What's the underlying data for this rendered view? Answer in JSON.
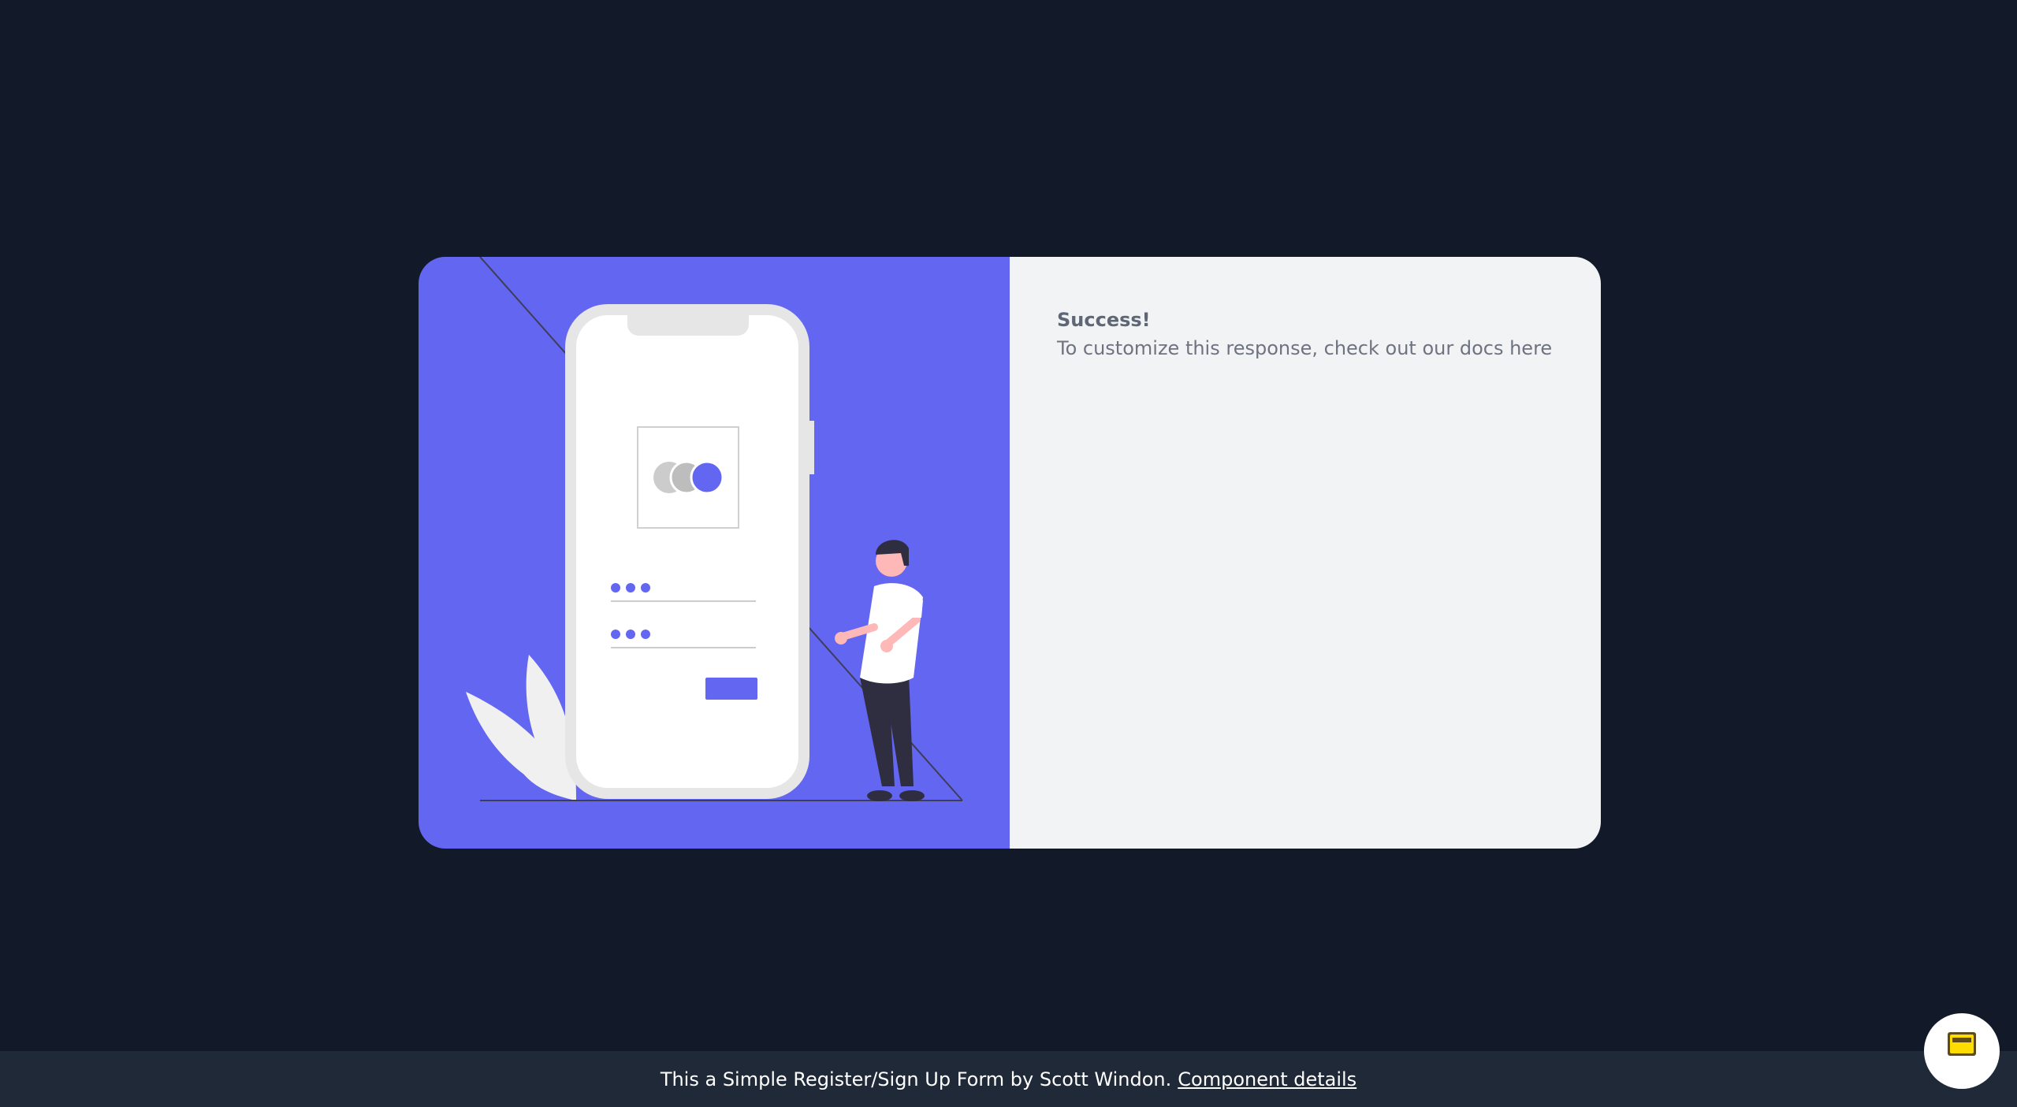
{
  "success_panel": {
    "title": "Success!",
    "message": "To customize this response, check out our docs here"
  },
  "footer": {
    "text": "This a Simple Register/Sign Up Form by Scott Windon.",
    "link_label": "Component details"
  },
  "colors": {
    "background": "#121929",
    "accent": "#6366f1",
    "panel": "#f2f3f5",
    "footer": "#1f2937"
  },
  "icons": {
    "illustration": "phone-login-illustration",
    "floating_button": "buy-me-a-coffee-icon"
  }
}
